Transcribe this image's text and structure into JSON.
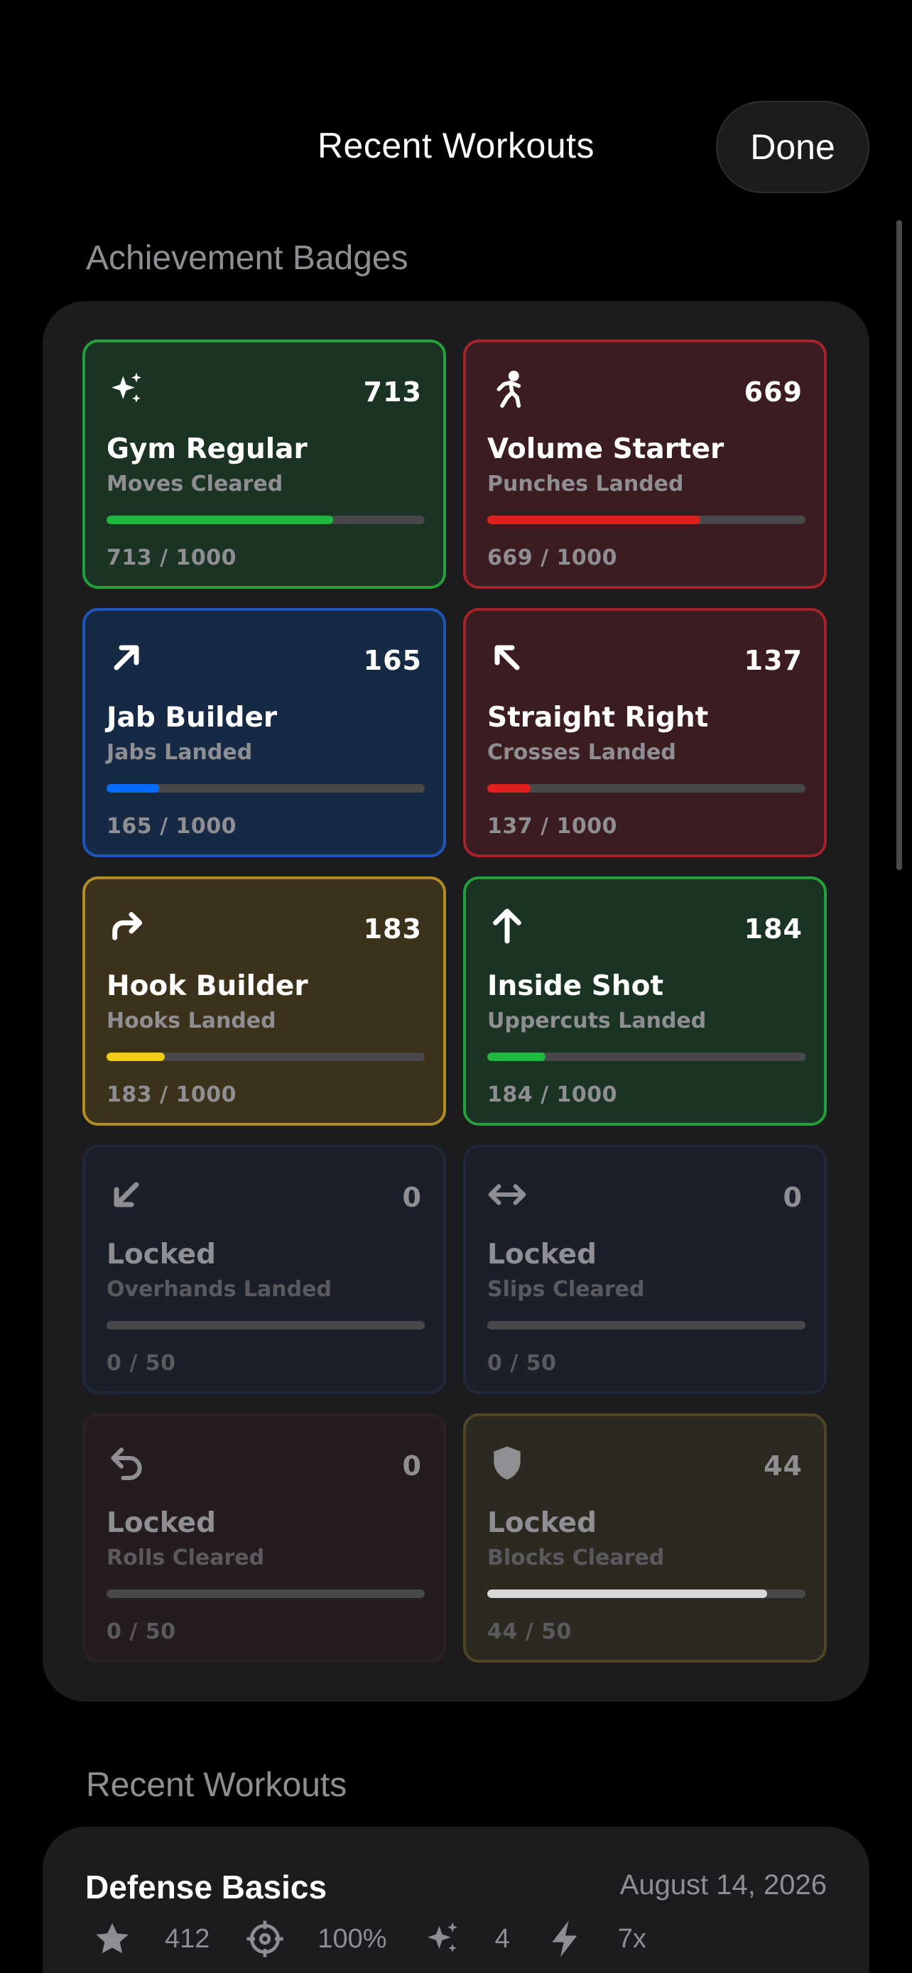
{
  "header": {
    "title": "Recent Workouts",
    "done_label": "Done"
  },
  "sections": {
    "achievements": "Achievement Badges",
    "recent": "Recent Workouts"
  },
  "badges": [
    {
      "icon": "sparkles-icon",
      "count": "713",
      "name": "Gym Regular",
      "subtitle": "Moves Cleared",
      "progress": "713 / 1000",
      "fraction": 0.713,
      "locked": false,
      "color": "#1fb83f",
      "bg": "#1a3322",
      "border": "#23a03a"
    },
    {
      "icon": "boxer-figure-icon",
      "count": "669",
      "name": "Volume Starter",
      "subtitle": "Punches Landed",
      "progress": "669 / 1000",
      "fraction": 0.669,
      "locked": false,
      "color": "#e0201c",
      "bg": "#3b1c20",
      "border": "#a3232a"
    },
    {
      "icon": "arrow-up-right-icon",
      "count": "165",
      "name": "Jab Builder",
      "subtitle": "Jabs Landed",
      "progress": "165 / 1000",
      "fraction": 0.165,
      "locked": false,
      "color": "#0a6cff",
      "bg": "#172a45",
      "border": "#1d56b8"
    },
    {
      "icon": "arrow-up-left-icon",
      "count": "137",
      "name": "Straight Right",
      "subtitle": "Crosses Landed",
      "progress": "137 / 1000",
      "fraction": 0.137,
      "locked": false,
      "color": "#e0201c",
      "bg": "#3b1c20",
      "border": "#a3232a"
    },
    {
      "icon": "hook-arrow-icon",
      "count": "183",
      "name": "Hook Builder",
      "subtitle": "Hooks Landed",
      "progress": "183 / 1000",
      "fraction": 0.183,
      "locked": false,
      "color": "#f2cc12",
      "bg": "#3c321c",
      "border": "#b08c22"
    },
    {
      "icon": "arrow-up-icon",
      "count": "184",
      "name": "Inside Shot",
      "subtitle": "Uppercuts Landed",
      "progress": "184 / 1000",
      "fraction": 0.184,
      "locked": false,
      "color": "#1fb83f",
      "bg": "#1a3322",
      "border": "#23a03a"
    },
    {
      "icon": "arrow-down-left-icon",
      "count": "0",
      "name": "Locked",
      "subtitle": "Overhands Landed",
      "progress": "0 / 50",
      "fraction": 0,
      "locked": true,
      "color": "#48484a",
      "bg": "#1b1f29",
      "border": "#202739"
    },
    {
      "icon": "left-right-arrow-icon",
      "count": "0",
      "name": "Locked",
      "subtitle": "Slips Cleared",
      "progress": "0 / 50",
      "fraction": 0,
      "locked": true,
      "color": "#48484a",
      "bg": "#1b1f29",
      "border": "#202739"
    },
    {
      "icon": "return-arrow-icon",
      "count": "0",
      "name": "Locked",
      "subtitle": "Rolls Cleared",
      "progress": "0 / 50",
      "fraction": 0,
      "locked": true,
      "color": "#48484a",
      "bg": "#251c1f",
      "border": "#2b2024"
    },
    {
      "icon": "shield-icon",
      "count": "44",
      "name": "Locked",
      "subtitle": "Blocks Cleared",
      "progress": "44 / 50",
      "fraction": 0.88,
      "locked": true,
      "color": "#d8d8d8",
      "bg": "#2b2920",
      "border": "#4d4524"
    }
  ],
  "workout": {
    "name": "Defense Basics",
    "date": "August 14, 2026",
    "stats": [
      {
        "icon": "star-icon",
        "value": "412"
      },
      {
        "icon": "crosshair-icon",
        "value": "100%"
      },
      {
        "icon": "sparkles-icon",
        "value": "4"
      },
      {
        "icon": "bolt-icon",
        "value": "7x"
      }
    ]
  }
}
